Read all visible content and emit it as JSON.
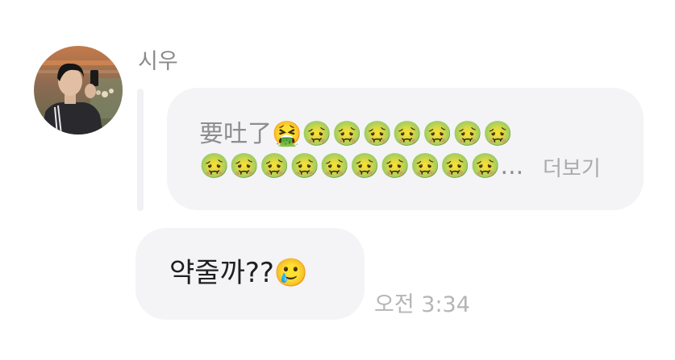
{
  "chat": {
    "sender_name": "시우",
    "quoted_message": {
      "text": "要吐了🤮🤢🤢🤢🤢🤢🤢🤢🤢🤢🤢🤢🤢🤢🤢🤢🤢🤢...",
      "more_label": "더보기"
    },
    "message": {
      "text": "약줄까??🥲"
    },
    "timestamp": "오전 3:34"
  },
  "colors": {
    "background": "#ffffff",
    "bubble": "#f4f4f6",
    "quoted_text": "#8d8d8d",
    "message_text": "#1f1f1f",
    "meta_text": "#b5b5b5"
  }
}
